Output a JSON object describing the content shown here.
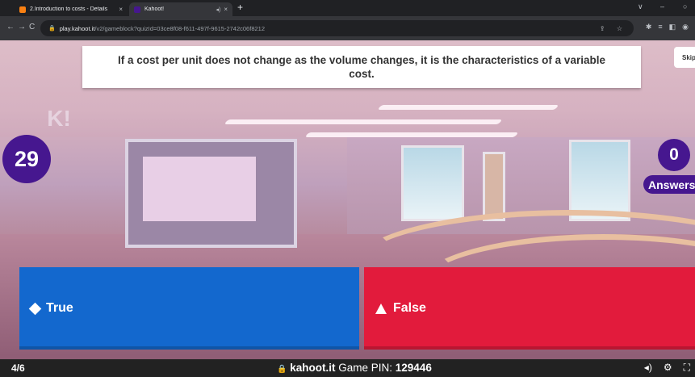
{
  "browser": {
    "tabs": [
      {
        "title": "2.Introduction to costs - Details",
        "active": false
      },
      {
        "title": "Kahoot!",
        "active": true
      }
    ],
    "url_host": "play.kahoot.it",
    "url_path": "/v2/gameblock?quizId=03ce8f08-f611-497f-9615-2742c06f8212",
    "new_tab": "+",
    "close": "×",
    "audio": "◂)",
    "window_controls": [
      "∨",
      "–",
      "○"
    ],
    "nav": [
      "←",
      "→",
      "C"
    ],
    "omni_icons": "⇪ ☆",
    "ext_icons": [
      "✱",
      "≡",
      "◧",
      "◉"
    ]
  },
  "game": {
    "question": "If a cost per unit does not change as the volume changes, it is the characteristics of a variable cost.",
    "skip_label": "Skip",
    "timer": "29",
    "answers_count": "0",
    "answers_label": "Answers",
    "logo": "K!",
    "options": [
      {
        "label": "True",
        "shape": "diamond",
        "color": "#1368ce"
      },
      {
        "label": "False",
        "shape": "triangle",
        "color": "#e21b3c"
      }
    ]
  },
  "footer": {
    "progress": "4/6",
    "lock": "🔒",
    "site": "kahoot.it",
    "pin_label": "Game PIN:",
    "pin": "129446",
    "icons": [
      "◂)",
      "⚙",
      "⛶"
    ]
  },
  "colors": {
    "accent": "#46178f",
    "true": "#1368ce",
    "false": "#e21b3c"
  }
}
